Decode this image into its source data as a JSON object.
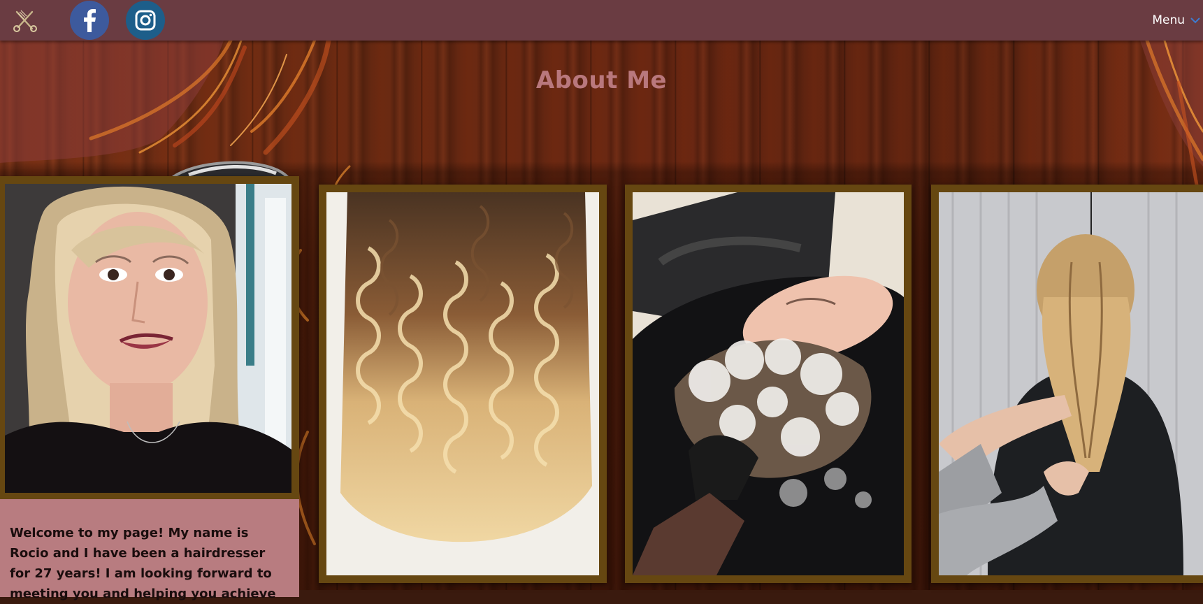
{
  "nav": {
    "logo_icon": "scissors-comb-icon",
    "social": [
      {
        "name": "facebook",
        "icon": "facebook-icon",
        "color": "#3d5a9d"
      },
      {
        "name": "instagram",
        "icon": "instagram-icon",
        "color": "#1d5e8a"
      }
    ],
    "menu_label": "Menu",
    "menu_icon": "chevron-down-icon"
  },
  "page": {
    "title": "About Me",
    "title_color": "#b9787d"
  },
  "gallery": [
    {
      "subject": "portrait of hairdresser"
    },
    {
      "subject": "blonde balayage curls"
    },
    {
      "subject": "hair washing at basin"
    },
    {
      "subject": "braiding blonde hair"
    }
  ],
  "bio": {
    "text": "Welcome to my page! My name is Rocio and I have been a hairdresser for 27 years! I am looking forward to meeting you and helping you achieve"
  },
  "colors": {
    "topbar": "#6a3c42",
    "card_frame": "#664711",
    "bio_background": "#b87c80",
    "accent_blue": "#3d7bd0"
  }
}
